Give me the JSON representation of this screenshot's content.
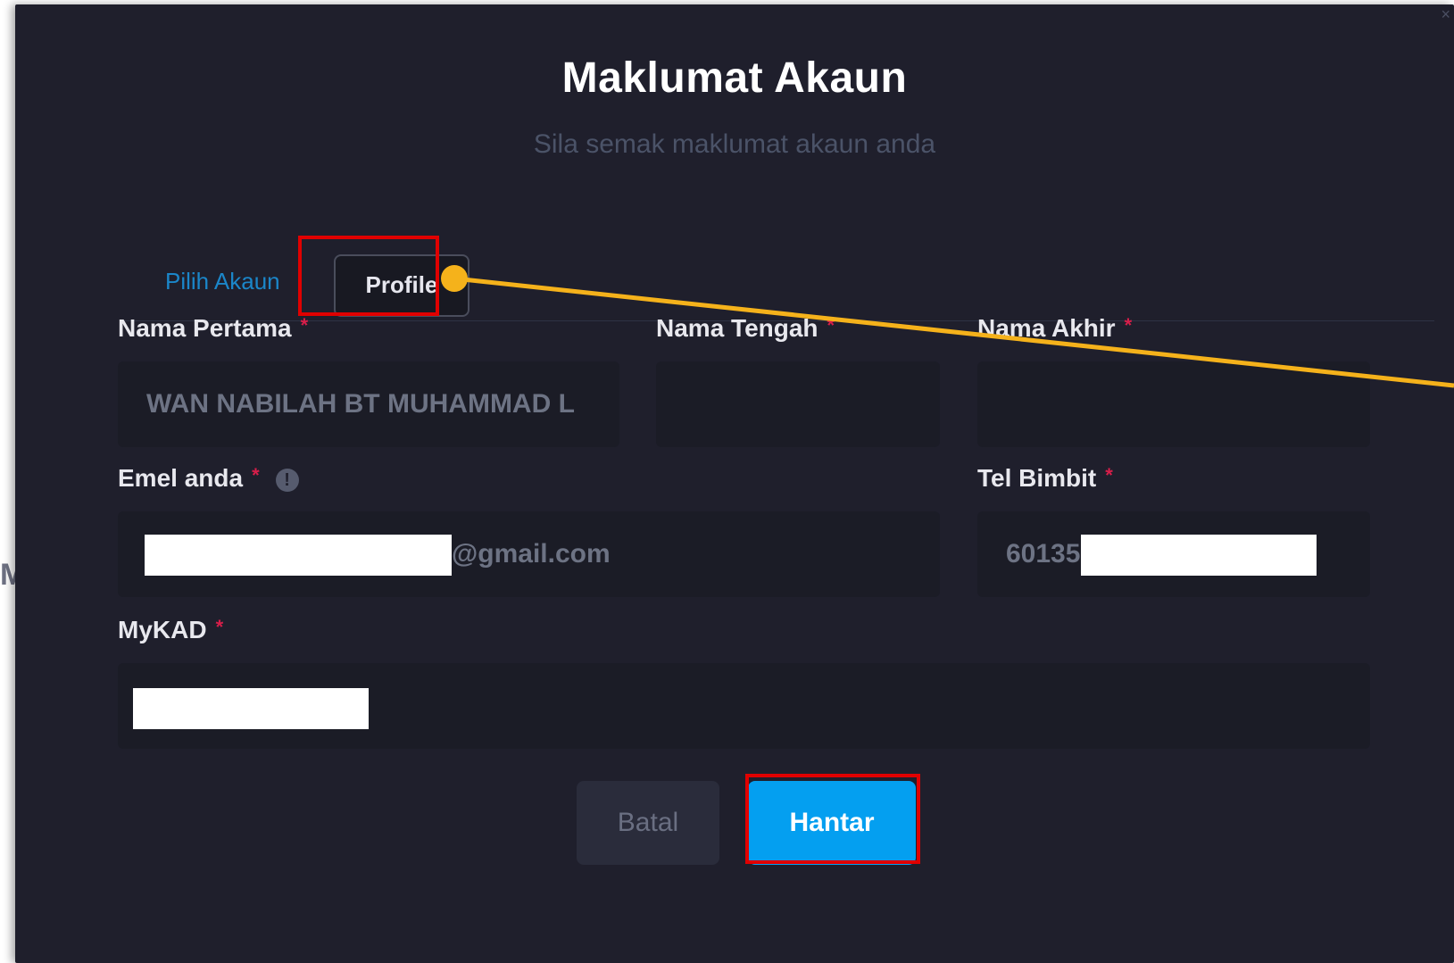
{
  "modal": {
    "title": "Maklumat Akaun",
    "subtitle": "Sila semak maklumat akaun anda",
    "close_icon": "close-icon",
    "left_edge_glyph": "M"
  },
  "tabs": [
    {
      "label": "Pilih Akaun",
      "active": false
    },
    {
      "label": "Profile",
      "active": true
    }
  ],
  "form": {
    "required_marker": "*",
    "first_name": {
      "label": "Nama Pertama",
      "value": "WAN NABILAH BT MUHAMMAD L"
    },
    "middle_name": {
      "label": "Nama Tengah",
      "value": ""
    },
    "last_name": {
      "label": "Nama Akhir",
      "value": ""
    },
    "email": {
      "label": "Emel anda",
      "value_suffix": "@gmail.com",
      "info_icon": "info-icon",
      "info_glyph": "!"
    },
    "phone": {
      "label": "Tel Bimbit",
      "value_prefix": "60135"
    },
    "mykad": {
      "label": "MyKAD",
      "value": ""
    }
  },
  "actions": {
    "cancel_label": "Batal",
    "submit_label": "Hantar"
  },
  "colors": {
    "modal_bg": "#1f1f2c",
    "accent": "#049ff0",
    "tab_link": "#1b86c9",
    "required": "#d81e4a",
    "highlight": "#e00000",
    "annotation_line": "#f5b21b"
  }
}
